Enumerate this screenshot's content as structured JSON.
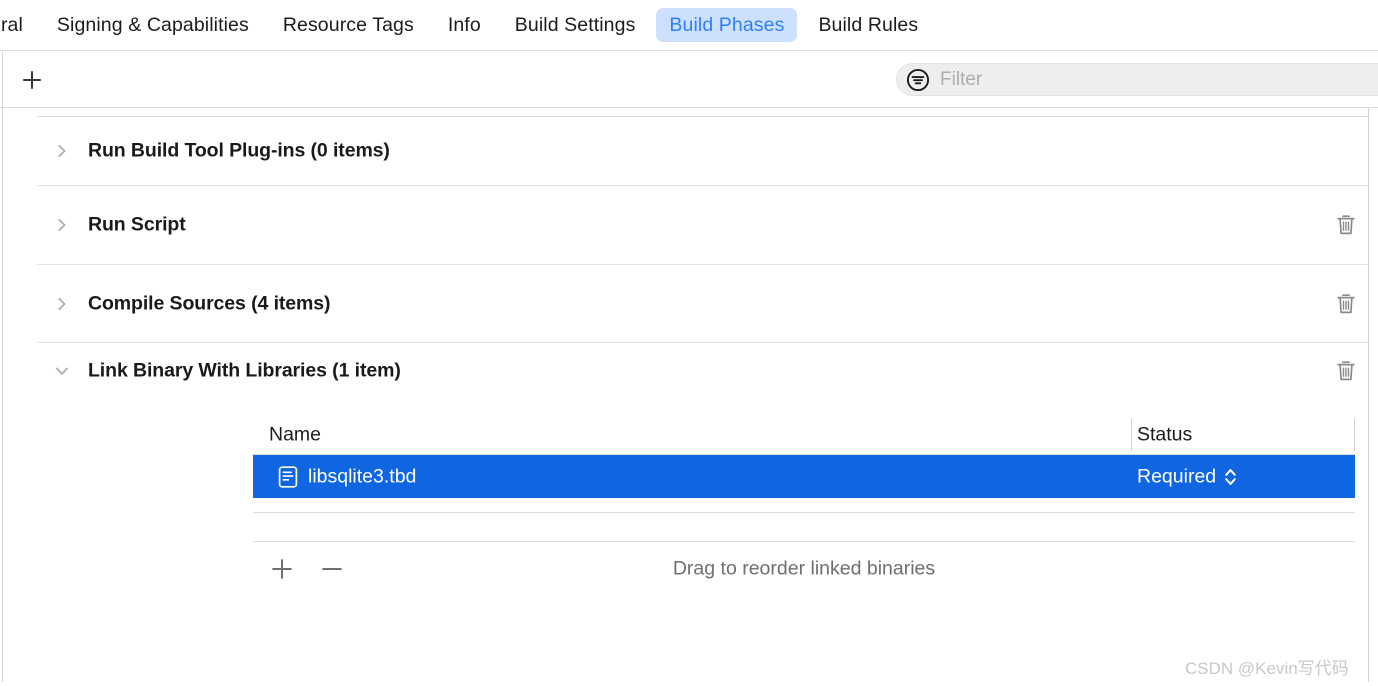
{
  "tabs": [
    {
      "label": "eral",
      "active": false,
      "clipped": true
    },
    {
      "label": "Signing & Capabilities",
      "active": false
    },
    {
      "label": "Resource Tags",
      "active": false
    },
    {
      "label": "Info",
      "active": false
    },
    {
      "label": "Build Settings",
      "active": false
    },
    {
      "label": "Build Phases",
      "active": true
    },
    {
      "label": "Build Rules",
      "active": false
    }
  ],
  "toolbar": {
    "add_icon": "plus-icon",
    "filter": {
      "icon": "filter-circle-icon",
      "placeholder": "Filter",
      "value": ""
    }
  },
  "phases": [
    {
      "id": "run-build-tool-plugins",
      "title": "Run Build Tool Plug-ins (0 items)",
      "expanded": false,
      "chevron": "chevron-right-icon",
      "has_delete": false,
      "delete_icon": "trash-icon"
    },
    {
      "id": "run-script",
      "title": "Run Script",
      "expanded": false,
      "chevron": "chevron-right-icon",
      "has_delete": true,
      "delete_icon": "trash-icon"
    },
    {
      "id": "compile-sources",
      "title": "Compile Sources (4 items)",
      "expanded": false,
      "chevron": "chevron-right-icon",
      "has_delete": true,
      "delete_icon": "trash-icon"
    },
    {
      "id": "link-binary-with-libraries",
      "title": "Link Binary With Libraries (1 item)",
      "expanded": true,
      "chevron": "chevron-down-icon",
      "has_delete": true,
      "delete_icon": "trash-icon"
    }
  ],
  "link_binary_table": {
    "columns": [
      "Name",
      "Status"
    ],
    "rows": [
      {
        "icon": "document-icon",
        "name": "libsqlite3.tbd",
        "status": "Required",
        "status_control": "up-down-chevron-icon",
        "selected": true
      }
    ],
    "footer": {
      "add_icon": "plus-icon",
      "remove_icon": "minus-icon",
      "hint": "Drag to reorder linked binaries"
    }
  },
  "watermark": "CSDN @Kevin写代码",
  "colors": {
    "accent_blue": "#1066e0",
    "tab_active_text": "#2f7ffd",
    "tab_active_bg": "#cde0fd",
    "icon_gray": "#8a8a8e",
    "hairline": "#e2e2e2"
  }
}
